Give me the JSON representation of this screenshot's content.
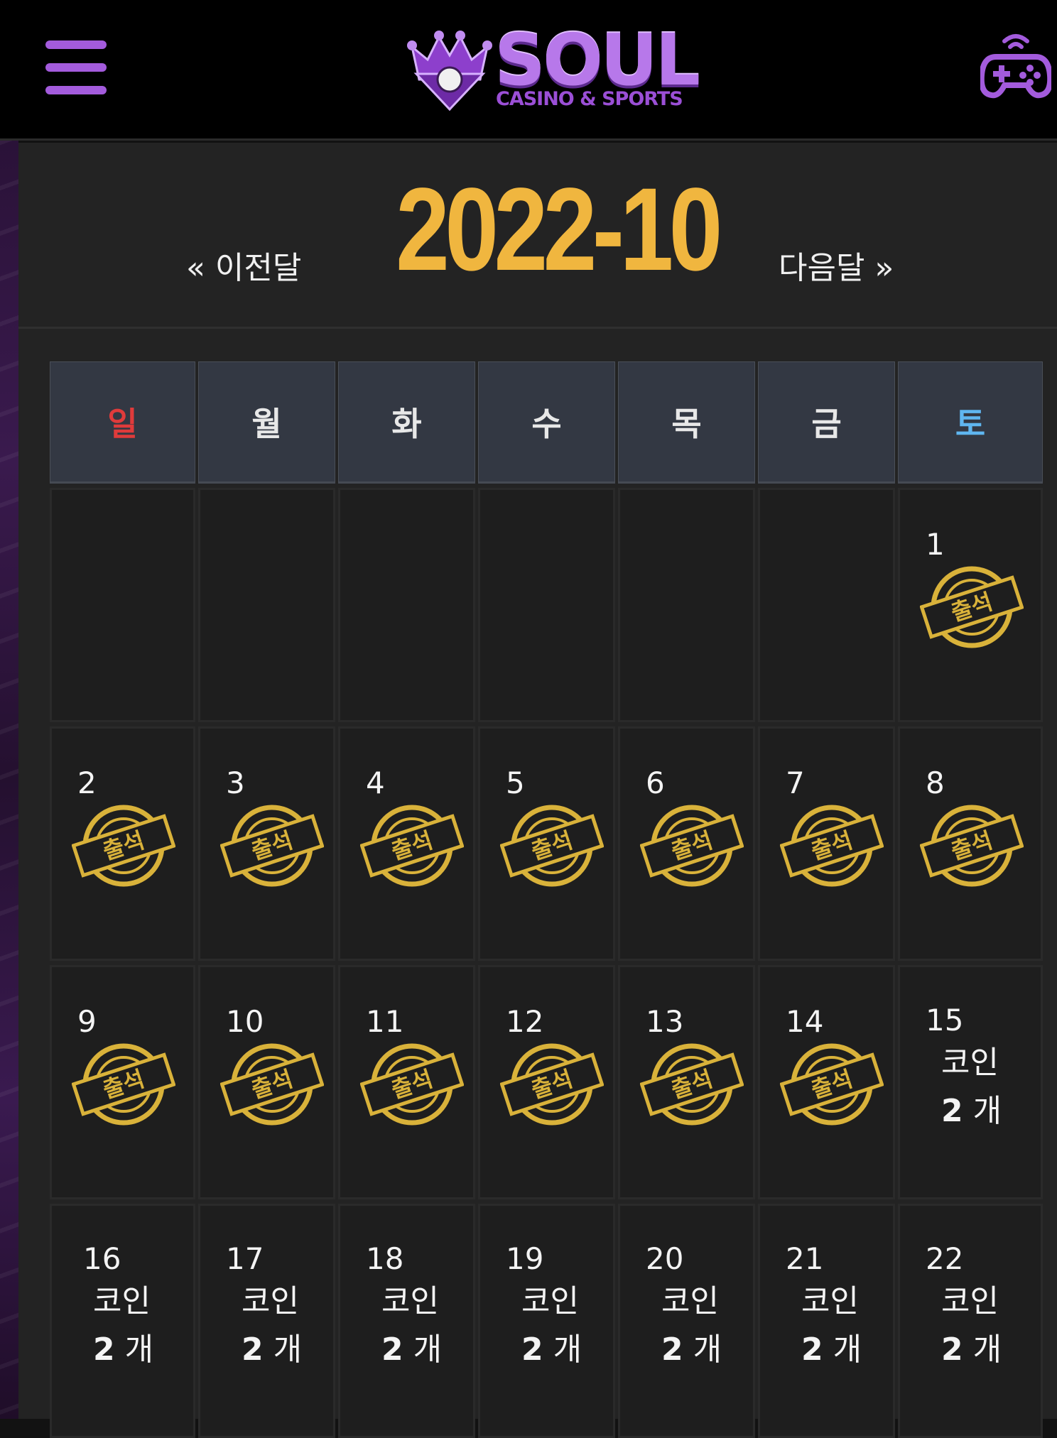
{
  "header": {
    "logo_text": "SOUL",
    "logo_subtitle": "CASINO & SPORTS",
    "menu_icon": "hamburger-menu-icon",
    "game_icon": "gamepad-icon",
    "accent_color": "#a35bdc"
  },
  "nav": {
    "prev_label": "« 이전달",
    "next_label": "다음달 »",
    "month": "2022-10",
    "month_color": "#f0b63f"
  },
  "calendar": {
    "weekdays": [
      "일",
      "월",
      "화",
      "수",
      "목",
      "금",
      "토"
    ],
    "stamp_label": "출석",
    "coin_label": "코인",
    "coin_unit": "개",
    "weeks": [
      [
        null,
        null,
        null,
        null,
        null,
        null,
        {
          "day": "1",
          "status": "attended"
        }
      ],
      [
        {
          "day": "2",
          "status": "attended"
        },
        {
          "day": "3",
          "status": "attended"
        },
        {
          "day": "4",
          "status": "attended"
        },
        {
          "day": "5",
          "status": "attended"
        },
        {
          "day": "6",
          "status": "attended"
        },
        {
          "day": "7",
          "status": "attended"
        },
        {
          "day": "8",
          "status": "attended"
        }
      ],
      [
        {
          "day": "9",
          "status": "attended"
        },
        {
          "day": "10",
          "status": "attended"
        },
        {
          "day": "11",
          "status": "attended"
        },
        {
          "day": "12",
          "status": "attended"
        },
        {
          "day": "13",
          "status": "attended"
        },
        {
          "day": "14",
          "status": "attended"
        },
        {
          "day": "15",
          "status": "coin",
          "coins": "2"
        }
      ],
      [
        {
          "day": "16",
          "status": "coin",
          "coins": "2"
        },
        {
          "day": "17",
          "status": "coin",
          "coins": "2"
        },
        {
          "day": "18",
          "status": "coin",
          "coins": "2"
        },
        {
          "day": "19",
          "status": "coin",
          "coins": "2"
        },
        {
          "day": "20",
          "status": "coin",
          "coins": "2"
        },
        {
          "day": "21",
          "status": "coin",
          "coins": "2"
        },
        {
          "day": "22",
          "status": "coin",
          "coins": "2"
        }
      ]
    ]
  }
}
